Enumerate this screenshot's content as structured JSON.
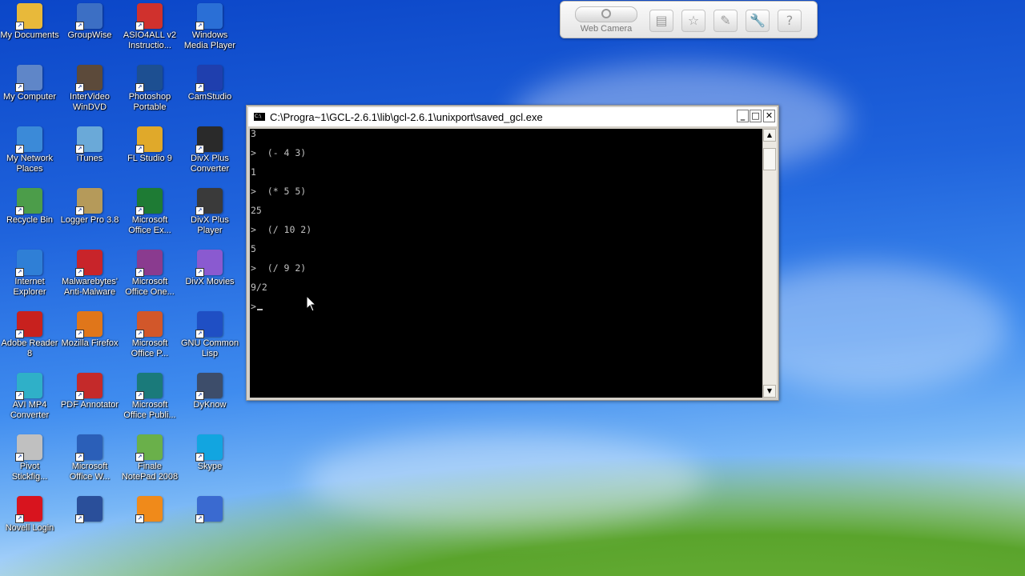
{
  "desktop_icons": [
    {
      "label": "My Documents",
      "icon": "folder-icon",
      "color": "#e8b93a"
    },
    {
      "label": "GroupWise",
      "icon": "groupwise-icon",
      "color": "#3c6fc4"
    },
    {
      "label": "ASIO4ALL v2\nInstructio...",
      "icon": "pdf-icon",
      "color": "#d0312d"
    },
    {
      "label": "Windows\nMedia Player",
      "icon": "media-player-icon",
      "color": "#2a6fd6"
    },
    {
      "label": "My Computer",
      "icon": "computer-icon",
      "color": "#5f86c8"
    },
    {
      "label": "InterVideo\nWinDVD",
      "icon": "windvd-icon",
      "color": "#5c4a3a"
    },
    {
      "label": "Photoshop\nPortable",
      "icon": "photoshop-icon",
      "color": "#1d4f91"
    },
    {
      "label": "CamStudio",
      "icon": "camstudio-icon",
      "color": "#1f3fae"
    },
    {
      "label": "My Network\nPlaces",
      "icon": "network-icon",
      "color": "#3b8ad8"
    },
    {
      "label": "iTunes",
      "icon": "itunes-icon",
      "color": "#6aa9d8"
    },
    {
      "label": "FL Studio 9",
      "icon": "fl-studio-icon",
      "color": "#e0a92a"
    },
    {
      "label": "DivX Plus\nConverter",
      "icon": "divx-converter-icon",
      "color": "#2a2a2a"
    },
    {
      "label": "Recycle Bin",
      "icon": "recycle-bin-icon",
      "color": "#4c9d4a"
    },
    {
      "label": "Logger Pro 3.8",
      "icon": "logger-pro-icon",
      "color": "#b59a5a"
    },
    {
      "label": "Microsoft\nOffice Ex...",
      "icon": "excel-icon",
      "color": "#1e7b34"
    },
    {
      "label": "DivX Plus\nPlayer",
      "icon": "divx-player-icon",
      "color": "#3a3a3a"
    },
    {
      "label": "Internet\nExplorer",
      "icon": "internet-explorer-icon",
      "color": "#2f7fd6"
    },
    {
      "label": "Malwarebytes'\nAnti-Malware",
      "icon": "malwarebytes-icon",
      "color": "#c8242a"
    },
    {
      "label": "Microsoft\nOffice One...",
      "icon": "onenote-icon",
      "color": "#8a3b8f"
    },
    {
      "label": "DivX Movies",
      "icon": "divx-movies-icon",
      "color": "#8a5ad0"
    },
    {
      "label": "Adobe Reader\n8",
      "icon": "adobe-reader-icon",
      "color": "#c8211e"
    },
    {
      "label": "Mozilla Firefox",
      "icon": "firefox-icon",
      "color": "#e0761a"
    },
    {
      "label": "Microsoft\nOffice P...",
      "icon": "powerpoint-icon",
      "color": "#d2572a"
    },
    {
      "label": "GNU Common\nLisp",
      "icon": "gnu-lisp-icon",
      "color": "#1f4fc4"
    },
    {
      "label": "AVI MP4\nConverter",
      "icon": "avi-converter-icon",
      "color": "#2fb0c8"
    },
    {
      "label": "PDF Annotator",
      "icon": "pdf-annotator-icon",
      "color": "#c42a2a"
    },
    {
      "label": "Microsoft\nOffice Publi...",
      "icon": "publisher-icon",
      "color": "#1a7a7a"
    },
    {
      "label": "DyKnow",
      "icon": "dyknow-icon",
      "color": "#3d4d6a"
    },
    {
      "label": "Pivot\nStickfig...",
      "icon": "pivot-icon",
      "color": "#c0c0c0"
    },
    {
      "label": "Microsoft\nOffice W...",
      "icon": "word-icon",
      "color": "#2b5fb8"
    },
    {
      "label": "Finale\nNotePad 2008",
      "icon": "finale-icon",
      "color": "#6ab04a"
    },
    {
      "label": "Skype",
      "icon": "skype-icon",
      "color": "#12a5e0"
    },
    {
      "label": "Novell Login",
      "icon": "novell-icon",
      "color": "#d8141e"
    },
    {
      "label": "",
      "icon": "google-earth-icon",
      "color": "#2a4f9a"
    },
    {
      "label": "",
      "icon": "vlc-icon",
      "color": "#f08a1a"
    },
    {
      "label": "",
      "icon": "app-icon",
      "color": "#3a6ad0"
    }
  ],
  "webcam_toolbar": {
    "label": "Web Camera",
    "buttons": [
      "snapshot-icon",
      "star-icon",
      "edit-icon",
      "wrench-icon",
      "help-icon"
    ]
  },
  "console": {
    "title": "C:\\Progra~1\\GCL-2.6.1\\lib\\gcl-2.6.1\\unixport\\saved_gcl.exe",
    "lines": [
      "3",
      ">  (- 4 3)",
      "1",
      ">  (* 5 5)",
      "25",
      ">  (/ 10 2)",
      "5",
      ">  (/ 9 2)",
      "9/2",
      ">"
    ]
  }
}
